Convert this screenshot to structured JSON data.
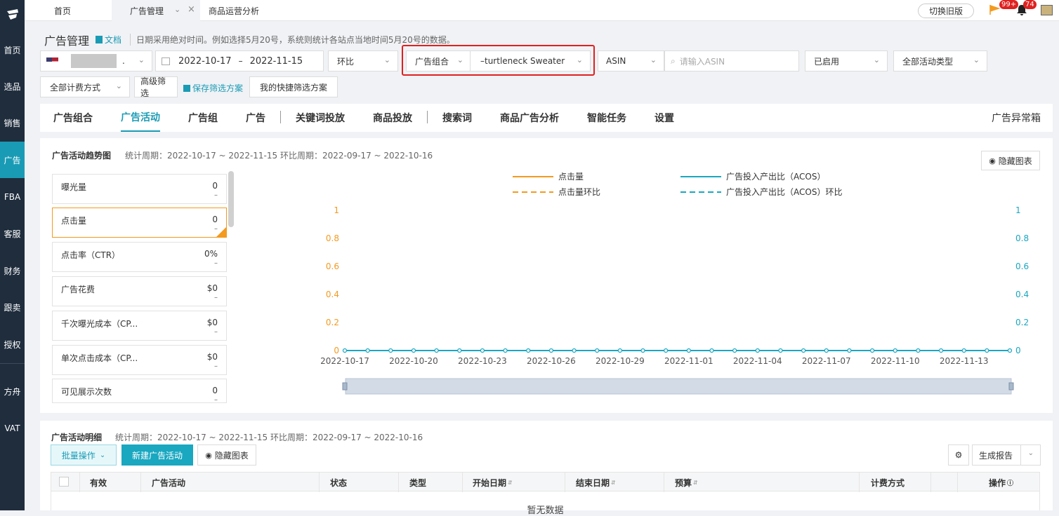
{
  "nav": {
    "items": [
      "首页",
      "选品",
      "销售",
      "广告",
      "FBA",
      "客服",
      "财务",
      "跟卖",
      "授权",
      "方舟",
      "VAT"
    ],
    "active": "广告"
  },
  "tabs": {
    "home": "首页",
    "ads": "广告管理",
    "analysis": "商品运营分析"
  },
  "header": {
    "switch_old": "切换旧版",
    "badge_msg": "99+",
    "badge_bell": "74"
  },
  "page": {
    "title": "广告管理",
    "doc_link": "文档",
    "hint": "日期采用绝对时间。例如选择5月20号，系统则统计各站点当地时间5月20号的数据。"
  },
  "filters": {
    "store_suffix": ".",
    "date_start": "2022-10-17",
    "date_sep": "–",
    "date_end": "2022-11-15",
    "compare": "环比",
    "portfolio_label": "广告组合",
    "portfolio_value": "–turtleneck Sweater",
    "asin_type": "ASIN",
    "asin_placeholder": "请输入ASIN",
    "status": "已启用",
    "campaign_type": "全部活动类型",
    "billing": "全部计费方式",
    "advanced": "高级筛选",
    "save_plan": "保存筛选方案",
    "my_plans": "我的快捷筛选方案"
  },
  "subtabs": [
    "广告组合",
    "广告活动",
    "广告组",
    "广告",
    "关键词投放",
    "商品投放",
    "搜索词",
    "商品广告分析",
    "智能任务",
    "设置"
  ],
  "subtabs_active": "广告活动",
  "anomaly_box": "广告异常箱",
  "trend": {
    "title": "广告活动趋势图",
    "period": "统计周期：2022-10-17 ~ 2022-11-15 环比周期：2022-09-17 ~ 2022-10-16",
    "hide_chart": "隐藏图表"
  },
  "metrics": [
    {
      "label": "曝光量",
      "value": "0",
      "delta": "–"
    },
    {
      "label": "点击量",
      "value": "0",
      "delta": "–"
    },
    {
      "label": "点击率（CTR）",
      "value": "0%",
      "delta": "–"
    },
    {
      "label": "广告花费",
      "value": "$0",
      "delta": "–"
    },
    {
      "label": "千次曝光成本（CP...",
      "value": "$0",
      "delta": "–"
    },
    {
      "label": "单次点击成本（CP...",
      "value": "$0",
      "delta": "–"
    },
    {
      "label": "可见展示次数",
      "value": "0",
      "delta": "–"
    }
  ],
  "chart_data": {
    "type": "line",
    "x": [
      "2022-10-17",
      "2022-10-18",
      "2022-10-19",
      "2022-10-20",
      "2022-10-21",
      "2022-10-22",
      "2022-10-23",
      "2022-10-24",
      "2022-10-25",
      "2022-10-26",
      "2022-10-27",
      "2022-10-28",
      "2022-10-29",
      "2022-10-30",
      "2022-10-31",
      "2022-11-01",
      "2022-11-02",
      "2022-11-03",
      "2022-11-04",
      "2022-11-05",
      "2022-11-06",
      "2022-11-07",
      "2022-11-08",
      "2022-11-09",
      "2022-11-10",
      "2022-11-11",
      "2022-11-12",
      "2022-11-13",
      "2022-11-14",
      "2022-11-15"
    ],
    "xticks": [
      "2022-10-17",
      "2022-10-20",
      "2022-10-23",
      "2022-10-26",
      "2022-10-29",
      "2022-11-01",
      "2022-11-04",
      "2022-11-07",
      "2022-11-10",
      "2022-11-13"
    ],
    "yticks_left": [
      "1",
      "0.8",
      "0.6",
      "0.4",
      "0.2",
      "0"
    ],
    "yticks_right": [
      "1",
      "0.8",
      "0.6",
      "0.4",
      "0.2",
      "0"
    ],
    "ylim": [
      0,
      1
    ],
    "series": [
      {
        "name": "点击量",
        "color": "#f39a1f",
        "style": "solid",
        "axis": "left",
        "values": [
          0,
          0,
          0,
          0,
          0,
          0,
          0,
          0,
          0,
          0,
          0,
          0,
          0,
          0,
          0,
          0,
          0,
          0,
          0,
          0,
          0,
          0,
          0,
          0,
          0,
          0,
          0,
          0,
          0,
          0
        ]
      },
      {
        "name": "点击量环比",
        "color": "#f39a1f",
        "style": "dashed",
        "axis": "left",
        "values": [
          0,
          0,
          0,
          0,
          0,
          0,
          0,
          0,
          0,
          0,
          0,
          0,
          0,
          0,
          0,
          0,
          0,
          0,
          0,
          0,
          0,
          0,
          0,
          0,
          0,
          0,
          0,
          0,
          0,
          0
        ]
      },
      {
        "name": "广告投入产出比（ACOS）",
        "color": "#1aa7c0",
        "style": "solid",
        "axis": "right",
        "values": [
          0,
          0,
          0,
          0,
          0,
          0,
          0,
          0,
          0,
          0,
          0,
          0,
          0,
          0,
          0,
          0,
          0,
          0,
          0,
          0,
          0,
          0,
          0,
          0,
          0,
          0,
          0,
          0,
          0,
          0
        ]
      },
      {
        "name": "广告投入产出比（ACOS）环比",
        "color": "#1aa7c0",
        "style": "dashed",
        "axis": "right",
        "values": [
          0,
          0,
          0,
          0,
          0,
          0,
          0,
          0,
          0,
          0,
          0,
          0,
          0,
          0,
          0,
          0,
          0,
          0,
          0,
          0,
          0,
          0,
          0,
          0,
          0,
          0,
          0,
          0,
          0,
          0
        ]
      }
    ],
    "legend": "top"
  },
  "detail": {
    "title": "广告活动明细",
    "period": "统计周期：2022-10-17 ~ 2022-11-15 环比周期：2022-09-17 ~ 2022-10-16",
    "batch": "批量操作",
    "new_campaign": "新建广告活动",
    "hide_chart": "隐藏图表",
    "report": "生成报告",
    "columns": [
      "有效",
      "广告活动",
      "状态",
      "类型",
      "开始日期",
      "结束日期",
      "预算",
      "计费方式",
      "操作"
    ],
    "empty": "暂无数据"
  }
}
